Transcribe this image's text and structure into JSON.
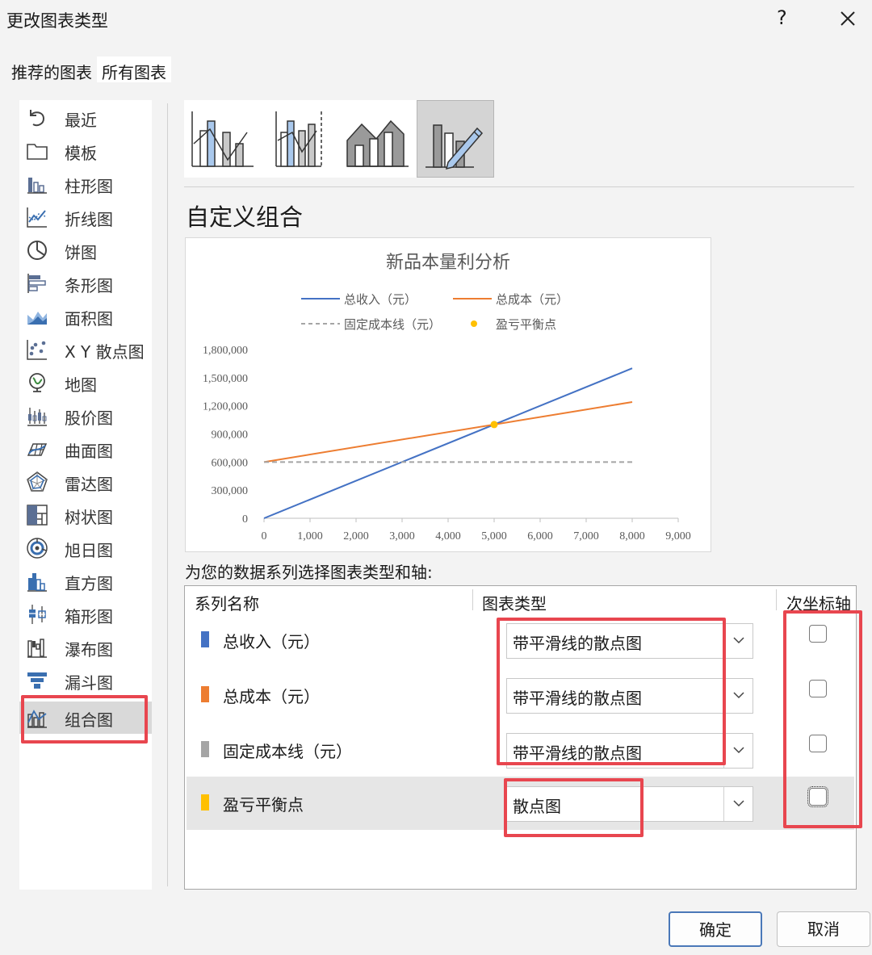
{
  "dialog": {
    "title": "更改图表类型",
    "help": "?"
  },
  "tabs": [
    {
      "label": "推荐的图表",
      "active": false
    },
    {
      "label": "所有图表",
      "active": true
    }
  ],
  "nav": [
    {
      "label": "最近",
      "icon": "undo-icon"
    },
    {
      "label": "模板",
      "icon": "folder-icon"
    },
    {
      "label": "柱形图",
      "icon": "column-chart-icon"
    },
    {
      "label": "折线图",
      "icon": "line-chart-icon"
    },
    {
      "label": "饼图",
      "icon": "pie-chart-icon"
    },
    {
      "label": "条形图",
      "icon": "bar-chart-icon"
    },
    {
      "label": "面积图",
      "icon": "area-chart-icon"
    },
    {
      "label": "X Y 散点图",
      "icon": "scatter-chart-icon"
    },
    {
      "label": "地图",
      "icon": "map-globe-icon"
    },
    {
      "label": "股价图",
      "icon": "stock-chart-icon"
    },
    {
      "label": "曲面图",
      "icon": "surface-chart-icon"
    },
    {
      "label": "雷达图",
      "icon": "radar-chart-icon"
    },
    {
      "label": "树状图",
      "icon": "treemap-icon"
    },
    {
      "label": "旭日图",
      "icon": "sunburst-icon"
    },
    {
      "label": "直方图",
      "icon": "histogram-icon"
    },
    {
      "label": "箱形图",
      "icon": "box-whisker-icon"
    },
    {
      "label": "瀑布图",
      "icon": "waterfall-icon"
    },
    {
      "label": "漏斗图",
      "icon": "funnel-icon"
    },
    {
      "label": "组合图",
      "icon": "combo-chart-icon",
      "selected": true
    }
  ],
  "subtypes": [
    {
      "icon": "clustered-column-line-icon"
    },
    {
      "icon": "column-line-secondary-axis-icon"
    },
    {
      "icon": "stacked-area-column-icon"
    },
    {
      "icon": "custom-combination-icon",
      "selected": true
    }
  ],
  "combo": {
    "heading": "自定义组合"
  },
  "chart_data": {
    "type": "scatter",
    "title": "新品本量利分析",
    "xlabel": "",
    "ylabel": "",
    "xlim": [
      0,
      9000
    ],
    "ylim": [
      0,
      1800000
    ],
    "x_ticks": [
      "0",
      "1,000",
      "2,000",
      "3,000",
      "4,000",
      "5,000",
      "6,000",
      "7,000",
      "8,000",
      "9,000"
    ],
    "y_ticks": [
      "0",
      "300,000",
      "600,000",
      "900,000",
      "1,200,000",
      "1,500,000",
      "1,800,000"
    ],
    "grid": false,
    "legend_position": "top",
    "series": [
      {
        "name": "总收入（元）",
        "style": "smooth-line",
        "color": "#4472c4",
        "x": [
          0,
          8000
        ],
        "y": [
          0,
          1600000
        ]
      },
      {
        "name": "总成本（元）",
        "style": "smooth-line",
        "color": "#ed7d31",
        "x": [
          0,
          8000
        ],
        "y": [
          600000,
          1240000
        ]
      },
      {
        "name": "固定成本线（元）",
        "style": "dashed-line",
        "color": "#a5a5a5",
        "x": [
          0,
          8000
        ],
        "y": [
          600000,
          600000
        ]
      },
      {
        "name": "盈亏平衡点",
        "style": "marker",
        "color": "#ffc000",
        "x": [
          5000
        ],
        "y": [
          1000000
        ]
      }
    ]
  },
  "series_section": {
    "prompt": "为您的数据系列选择图表类型和轴:",
    "headers": {
      "name": "系列名称",
      "type": "图表类型",
      "secondary": "次坐标轴"
    },
    "rows": [
      {
        "name": "总收入（元）",
        "color": "#4472c4",
        "chart_type": "带平滑线的散点图",
        "secondary_axis": false
      },
      {
        "name": "总成本（元）",
        "color": "#ed7d31",
        "chart_type": "带平滑线的散点图",
        "secondary_axis": false
      },
      {
        "name": "固定成本线（元）",
        "color": "#a5a5a5",
        "chart_type": "带平滑线的散点图",
        "secondary_axis": false
      },
      {
        "name": "盈亏平衡点",
        "color": "#ffc000",
        "chart_type": "散点图",
        "secondary_axis": false
      }
    ]
  },
  "buttons": {
    "ok": "确定",
    "cancel": "取消"
  },
  "colors": {
    "highlight_annotation": "#e8464f",
    "selection_bg": "#d9d9d9"
  }
}
